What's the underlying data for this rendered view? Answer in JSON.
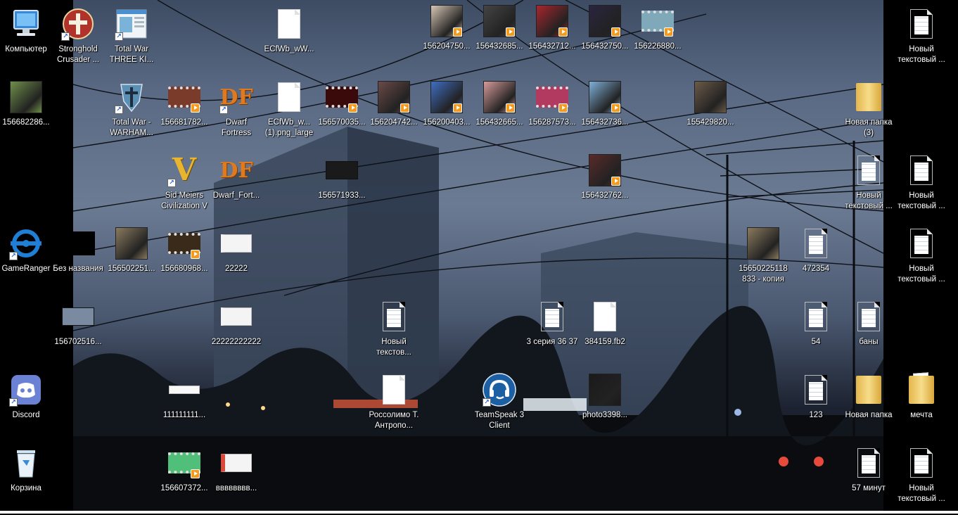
{
  "desktop": {
    "icons": [
      {
        "label": "Компьютер",
        "icon": "computer-icon",
        "kind": "computer"
      },
      {
        "label": "Stronghold Crusader ...",
        "icon": "stronghold-icon",
        "kind": "app",
        "shortcut": true
      },
      {
        "label": "Total War THREE KI...",
        "icon": "total-war-icon",
        "kind": "window",
        "shortcut": true
      },
      {
        "label": "ECfWb_wW...",
        "icon": "blank-file-icon",
        "kind": "blank"
      },
      {
        "label": "156204750...",
        "icon": "video-thumbnail-icon",
        "kind": "img",
        "color": "#d7c6b5",
        "play": true
      },
      {
        "label": "156432685...",
        "icon": "video-thumbnail-icon",
        "kind": "img",
        "color": "#444",
        "play": true
      },
      {
        "label": "156432712...",
        "icon": "video-thumbnail-icon",
        "kind": "img",
        "color": "#a8262e",
        "play": true
      },
      {
        "label": "156432750...",
        "icon": "video-thumbnail-icon",
        "kind": "img",
        "color": "#2a2540",
        "play": true
      },
      {
        "label": "156226880...",
        "icon": "video-thumbnail-icon",
        "kind": "film",
        "color": "#7fa8b8",
        "play": true
      },
      {
        "label": "Новый текстовый ...",
        "icon": "text-document-icon",
        "kind": "doc"
      },
      {
        "label": "156682286...",
        "icon": "image-thumbnail-icon",
        "kind": "img",
        "color": "#6f8f4a"
      },
      {
        "label": "Total War - WARHAM...",
        "icon": "warhammer-icon",
        "kind": "app",
        "shortcut": true
      },
      {
        "label": "156681782...",
        "icon": "video-thumbnail-icon",
        "kind": "film",
        "color": "#7a3b2a",
        "play": true
      },
      {
        "label": "Dwarf Fortress",
        "icon": "dwarf-fortress-icon",
        "kind": "df",
        "shortcut": true
      },
      {
        "label": "ECfWb_w... (1).png_large",
        "icon": "blank-file-icon",
        "kind": "blank"
      },
      {
        "label": "156570035...",
        "icon": "video-thumbnail-icon",
        "kind": "film",
        "color": "#3a0a0a",
        "play": true
      },
      {
        "label": "156204742...",
        "icon": "video-thumbnail-icon",
        "kind": "img",
        "color": "#6a4a48",
        "play": true
      },
      {
        "label": "156200403...",
        "icon": "video-thumbnail-icon",
        "kind": "img",
        "color": "#3f6ec4",
        "play": true
      },
      {
        "label": "156432665...",
        "icon": "video-thumbnail-icon",
        "kind": "img",
        "color": "#d79a9a",
        "play": true
      },
      {
        "label": "156287573...",
        "icon": "video-thumbnail-icon",
        "kind": "film",
        "color": "#b23a60",
        "play": true
      },
      {
        "label": "156432736...",
        "icon": "video-thumbnail-icon",
        "kind": "img",
        "color": "#7fb0d8",
        "play": true
      },
      {
        "label": "155429820...",
        "icon": "image-thumbnail-icon",
        "kind": "img",
        "color": "#6b5a48"
      },
      {
        "label": "Новая папка (3)",
        "icon": "folder-icon",
        "kind": "folder"
      },
      {
        "label": "Sid Meiers Civilization V",
        "icon": "civilization-icon",
        "kind": "civ",
        "shortcut": true
      },
      {
        "label": "Dwarf_Fort...",
        "icon": "dwarf-fortress-icon",
        "kind": "df"
      },
      {
        "label": "156571933...",
        "icon": "video-thumbnail-icon",
        "kind": "wide",
        "color": "#1a1a1a"
      },
      {
        "label": "156432762...",
        "icon": "video-thumbnail-icon",
        "kind": "img",
        "color": "#5a2a2a",
        "play": true
      },
      {
        "label": "Новый текстовый ...",
        "icon": "text-document-icon",
        "kind": "doc"
      },
      {
        "label": "Новый текстовый ...",
        "icon": "text-document-icon",
        "kind": "doc"
      },
      {
        "label": "GameRanger",
        "icon": "gameranger-icon",
        "kind": "gameranger",
        "shortcut": true
      },
      {
        "label": "Без названия",
        "icon": "image-thumbnail-icon",
        "kind": "black"
      },
      {
        "label": "156502251...",
        "icon": "image-thumbnail-icon",
        "kind": "img",
        "color": "#8a7a5e"
      },
      {
        "label": "156680968...",
        "icon": "video-thumbnail-icon",
        "kind": "film",
        "color": "#3a2a1a",
        "play": true
      },
      {
        "label": "22222",
        "icon": "image-thumbnail-icon",
        "kind": "paper"
      },
      {
        "label": "15650225118 833 - копия",
        "icon": "image-thumbnail-icon",
        "kind": "img",
        "color": "#8a7a5e"
      },
      {
        "label": "472354",
        "icon": "text-document-icon",
        "kind": "doc"
      },
      {
        "label": "Новый текстовый ...",
        "icon": "text-document-icon",
        "kind": "doc"
      },
      {
        "label": "156702516...",
        "icon": "image-thumbnail-icon",
        "kind": "wide",
        "color": "#7a8aa0"
      },
      {
        "label": "22222222222",
        "icon": "image-thumbnail-icon",
        "kind": "paper"
      },
      {
        "label": "Новый текстов...",
        "icon": "text-document-icon",
        "kind": "doc"
      },
      {
        "label": "3 серия 36 37",
        "icon": "text-document-icon",
        "kind": "doc"
      },
      {
        "label": "384159.fb2",
        "icon": "blank-file-icon",
        "kind": "blank"
      },
      {
        "label": "54",
        "icon": "text-document-icon",
        "kind": "doc"
      },
      {
        "label": "баны",
        "icon": "text-document-icon",
        "kind": "doc"
      },
      {
        "label": "Discord",
        "icon": "discord-icon",
        "kind": "discord",
        "shortcut": true
      },
      {
        "label": "111111111...",
        "icon": "image-thumbnail-icon",
        "kind": "strip"
      },
      {
        "label": "Россолимо Т. Антропо...",
        "icon": "blank-file-icon",
        "kind": "blank"
      },
      {
        "label": "TeamSpeak 3 Client",
        "icon": "teamspeak-icon",
        "kind": "teamspeak",
        "shortcut": true
      },
      {
        "label": "photo3398...",
        "icon": "image-thumbnail-icon",
        "kind": "img",
        "color": "#1a1a1a"
      },
      {
        "label": "123",
        "icon": "text-document-icon",
        "kind": "doc"
      },
      {
        "label": "Новая папка",
        "icon": "folder-icon",
        "kind": "folder"
      },
      {
        "label": "мечта",
        "icon": "folder-icon",
        "kind": "folder"
      },
      {
        "label": "Корзина",
        "icon": "recycle-bin-icon",
        "kind": "bin"
      },
      {
        "label": "156607372...",
        "icon": "video-thumbnail-icon",
        "kind": "film",
        "color": "#4fbf7a",
        "play": true
      },
      {
        "label": "вввввввв...",
        "icon": "image-thumbnail-icon",
        "kind": "paper",
        "color": "#d84b3a"
      },
      {
        "label": "57 минут",
        "icon": "text-document-icon",
        "kind": "doc"
      },
      {
        "label": "Новый текстовый ...",
        "icon": "text-document-icon",
        "kind": "doc"
      }
    ]
  }
}
